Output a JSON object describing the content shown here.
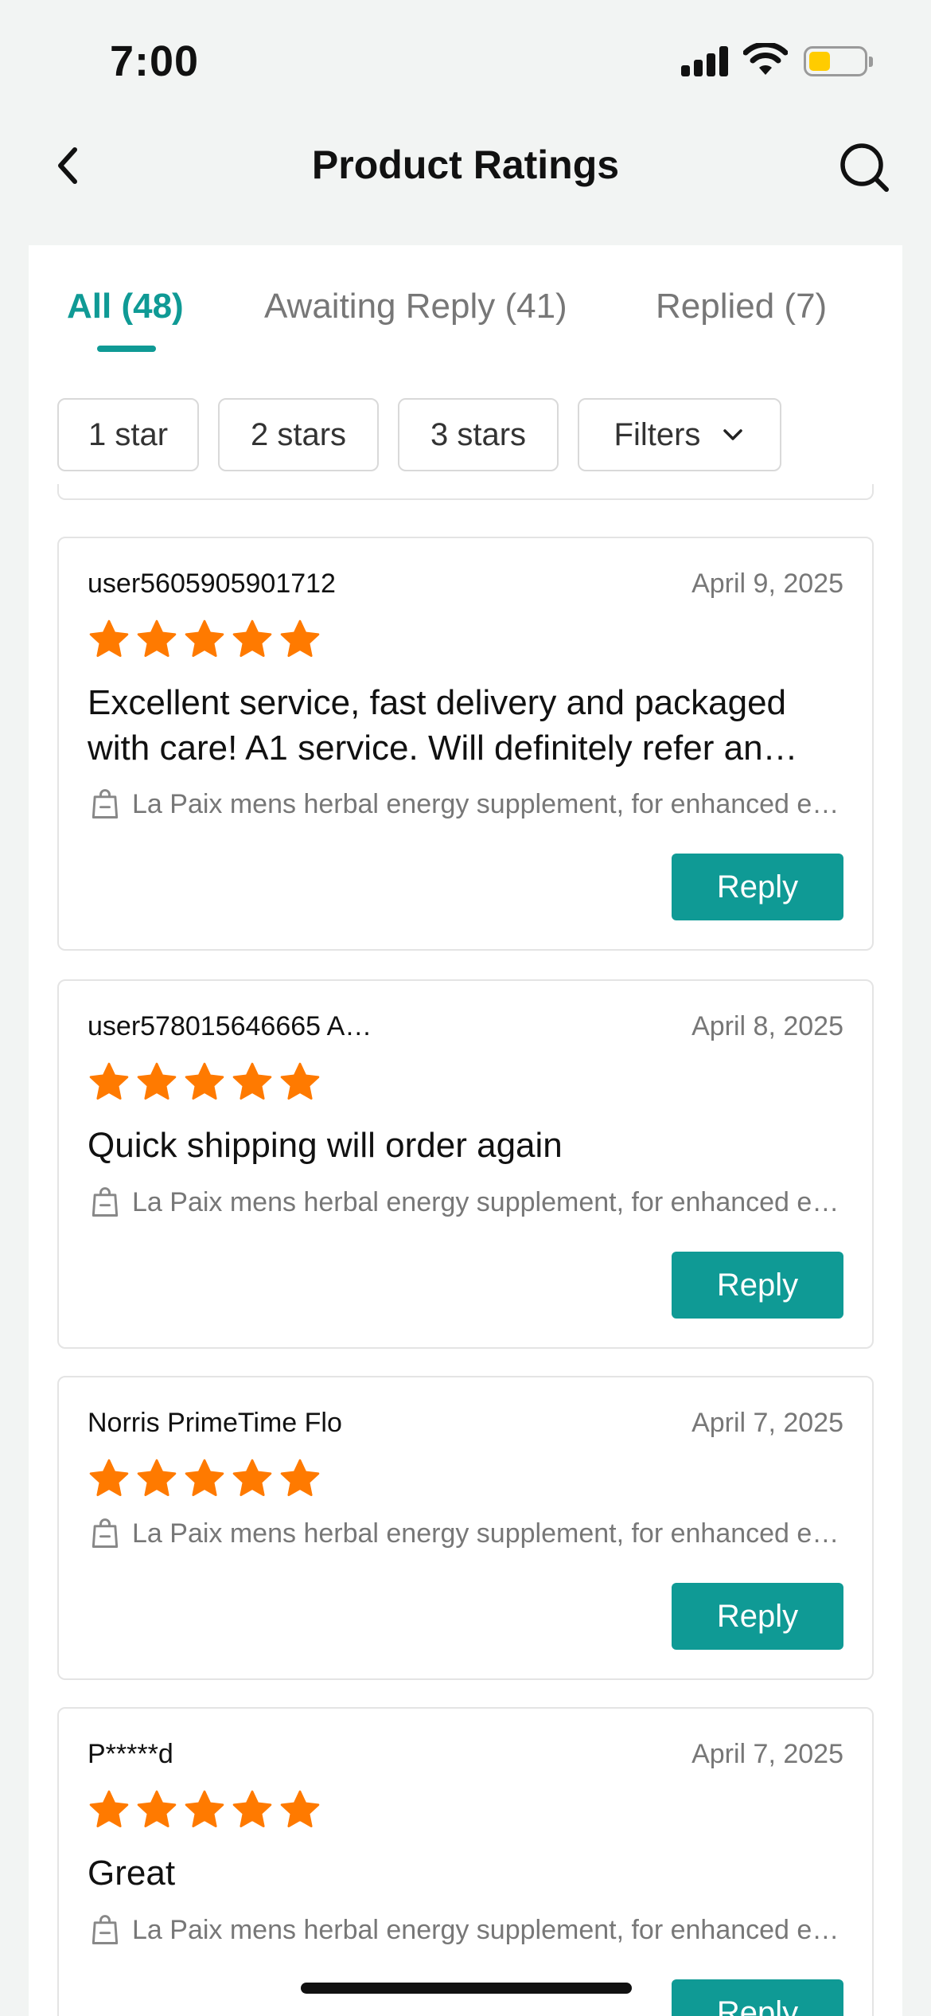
{
  "status_bar": {
    "time": "7:00"
  },
  "nav": {
    "title": "Product Ratings"
  },
  "tabs": [
    {
      "label": "All (48)",
      "active": true
    },
    {
      "label": "Awaiting Reply (41)",
      "active": false
    },
    {
      "label": "Replied (7)",
      "active": false
    }
  ],
  "filters": {
    "chips": [
      "1 star",
      "2 stars",
      "3 stars"
    ],
    "filters_label": "Filters"
  },
  "colors": {
    "accent": "#0f9a95",
    "star": "#ff7a00"
  },
  "reviews": [
    {
      "username": "user5605905901712",
      "date": "April 9, 2025",
      "rating": 5,
      "comment": "Excellent service, fast delivery and packaged with care! A1 service. Will definitely refer an…",
      "product": "La Paix mens herbal energy supplement, for enhanced en…",
      "reply_label": "Reply"
    },
    {
      "username": "user578015646665 A…",
      "date": "April 8, 2025",
      "rating": 5,
      "comment": "Quick shipping will order again",
      "product": "La Paix mens herbal energy supplement, for enhanced en…",
      "reply_label": "Reply"
    },
    {
      "username": "Norris PrimeTime Flo",
      "date": "April 7, 2025",
      "rating": 5,
      "comment": "",
      "product": "La Paix mens herbal energy supplement, for enhanced en…",
      "reply_label": "Reply"
    },
    {
      "username": "P*****d",
      "date": "April 7, 2025",
      "rating": 5,
      "comment": "Great",
      "product": "La Paix mens herbal energy supplement, for enhanced en…",
      "reply_label": "Reply"
    }
  ]
}
